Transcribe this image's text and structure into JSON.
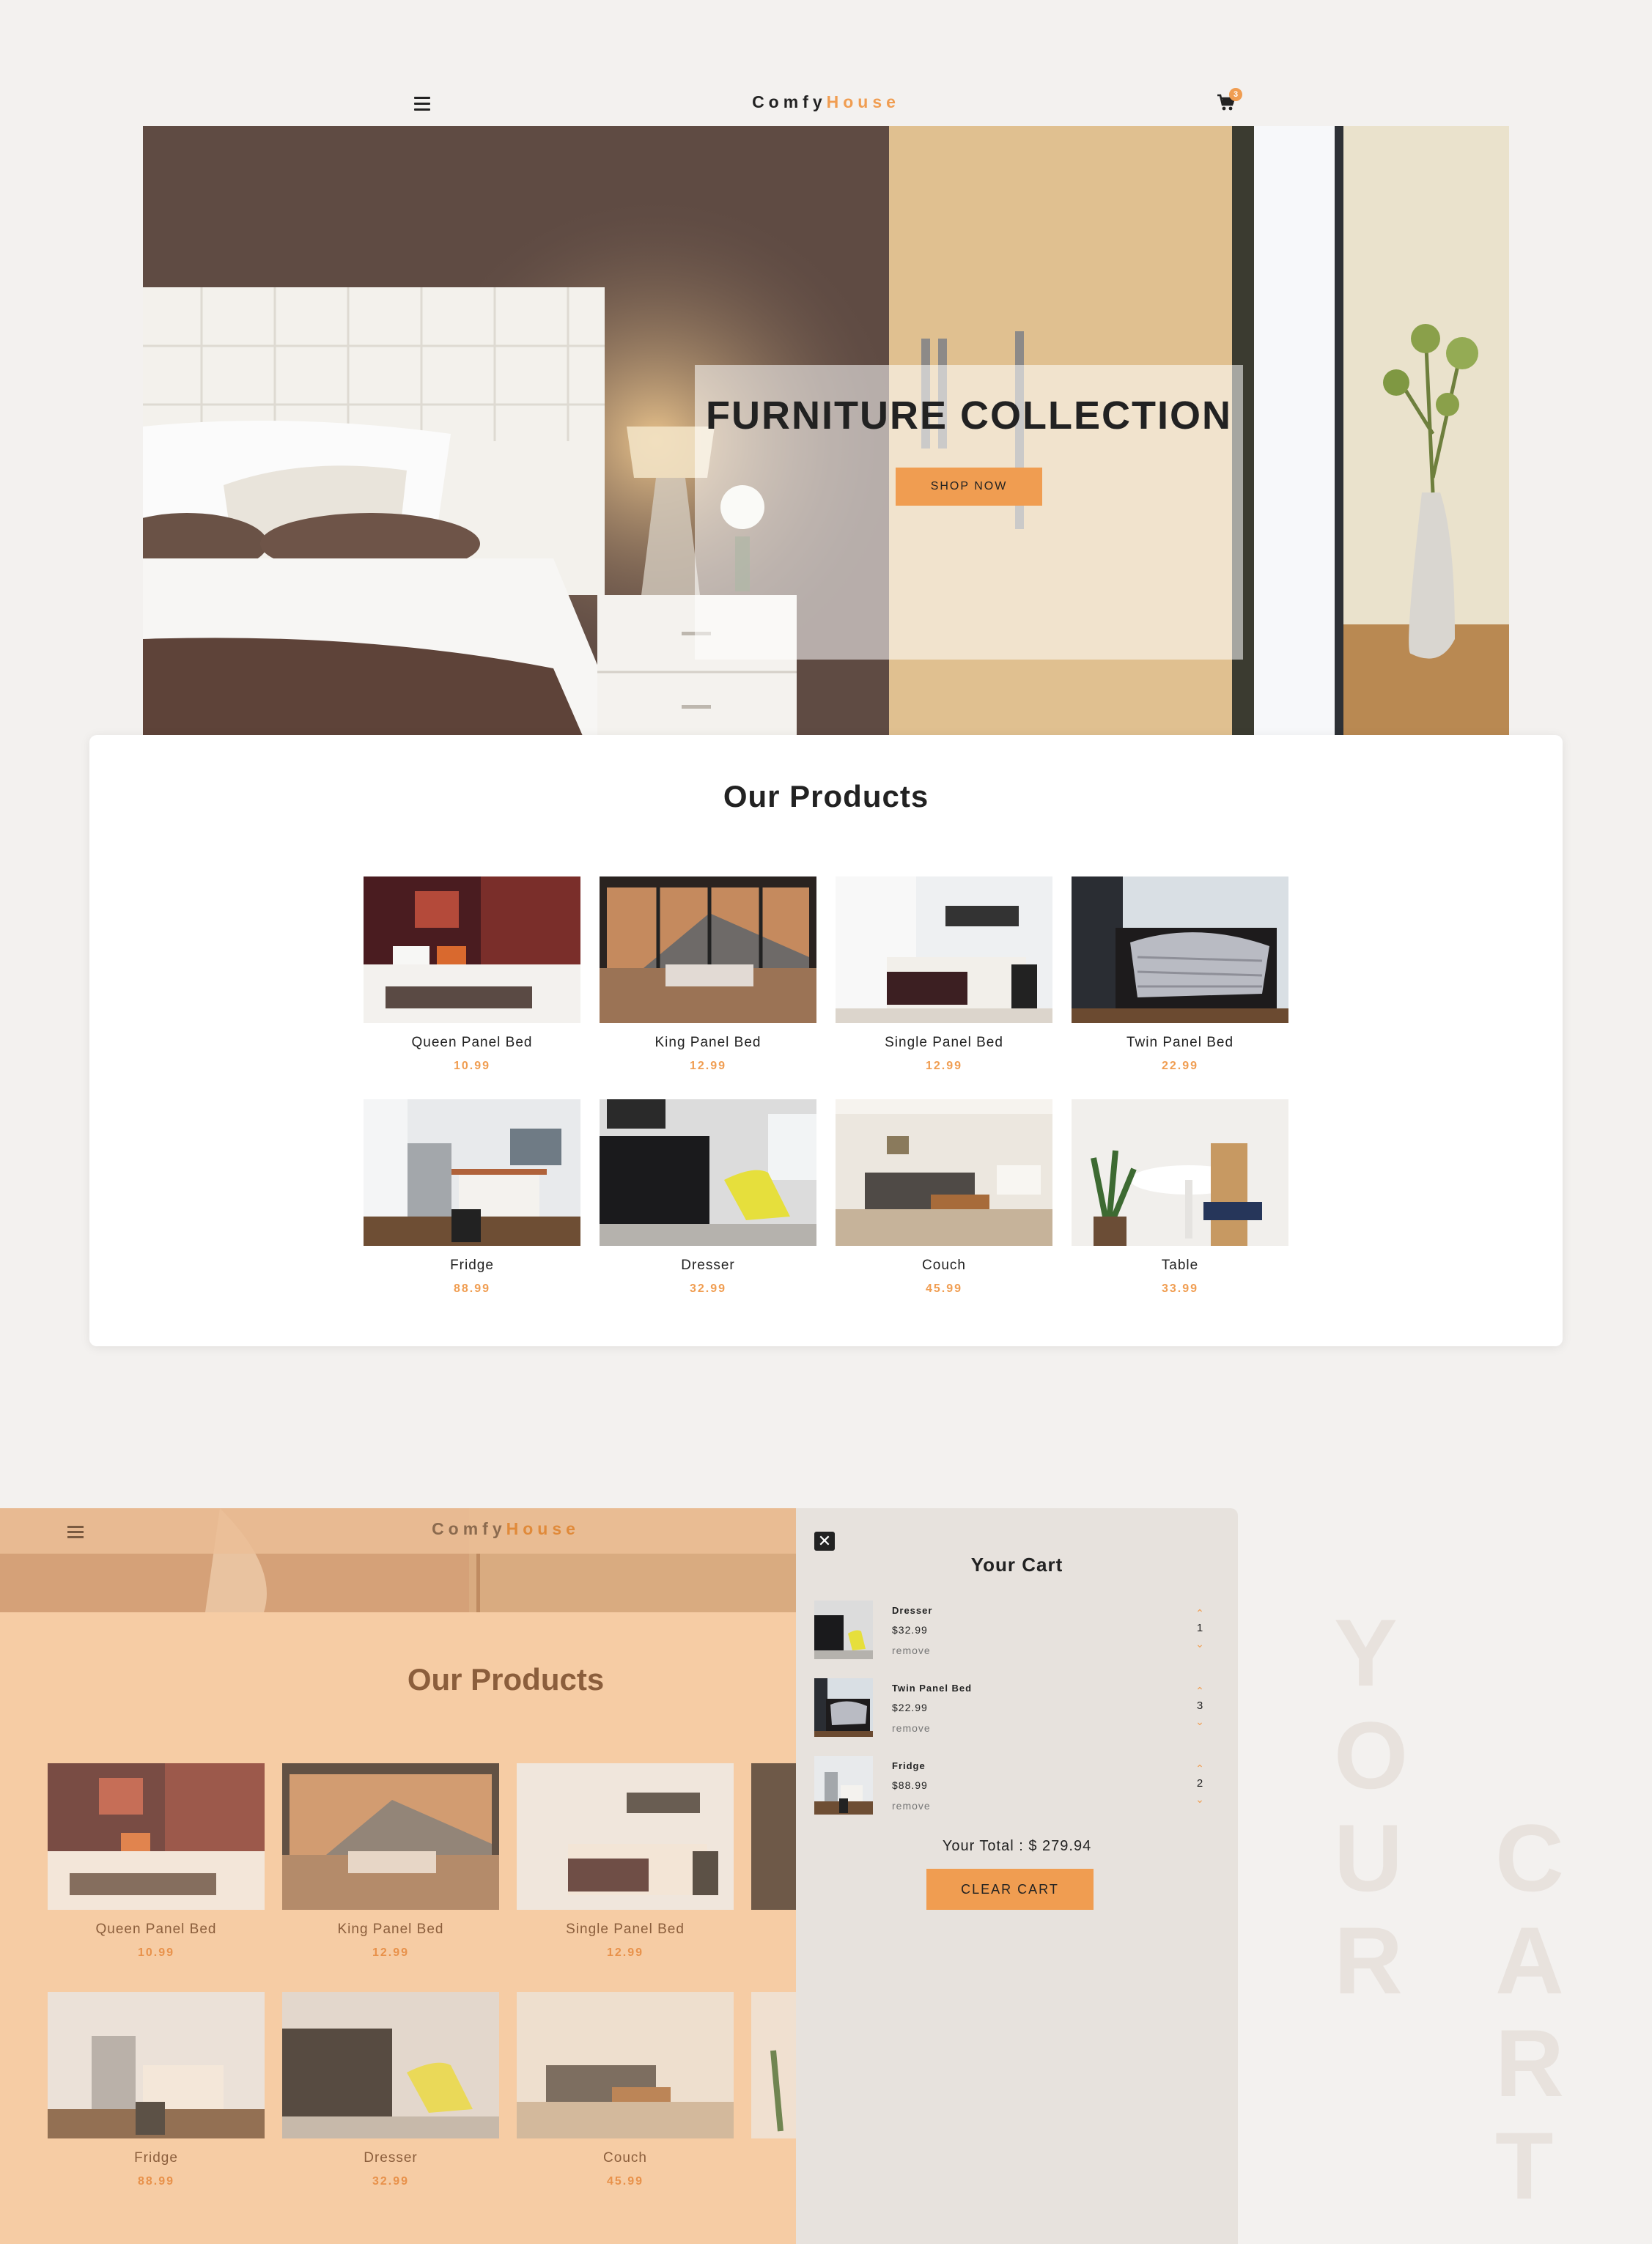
{
  "brand": {
    "part1": "Comfy",
    "part2": "House"
  },
  "cart_badge_count": "3",
  "hero": {
    "title": "FURNITURE COLLECTION",
    "button": "SHOP NOW"
  },
  "products_title": "Our Products",
  "products": [
    {
      "name": "Queen Panel Bed",
      "price": "10.99"
    },
    {
      "name": "King Panel Bed",
      "price": "12.99"
    },
    {
      "name": "Single Panel Bed",
      "price": "12.99"
    },
    {
      "name": "Twin Panel Bed",
      "price": "22.99"
    },
    {
      "name": "Fridge",
      "price": "88.99"
    },
    {
      "name": "Dresser",
      "price": "32.99"
    },
    {
      "name": "Couch",
      "price": "45.99"
    },
    {
      "name": "Table",
      "price": "33.99"
    }
  ],
  "cart": {
    "title": "Your Cart",
    "items": [
      {
        "name": "Dresser",
        "price": "$32.99",
        "remove": "remove",
        "qty": "1"
      },
      {
        "name": "Twin Panel Bed",
        "price": "$22.99",
        "remove": "remove",
        "qty": "3"
      },
      {
        "name": "Fridge",
        "price": "$88.99",
        "remove": "remove",
        "qty": "2"
      }
    ],
    "total_label": "Your Total : $ 279.94",
    "clear_button": "CLEAR CART"
  },
  "side_text": {
    "col1": [
      "Y",
      "O",
      "U",
      "R"
    ],
    "col2": [
      "C",
      "A",
      "R",
      "T"
    ]
  },
  "colors": {
    "accent": "#f09d51",
    "background": "#f3f1ef",
    "cart_panel": "#e7e2dd",
    "overlay": "#f6cca4"
  },
  "icons": [
    "hamburger-icon",
    "cart-icon",
    "close-icon",
    "chevron-up-icon",
    "chevron-down-icon"
  ]
}
